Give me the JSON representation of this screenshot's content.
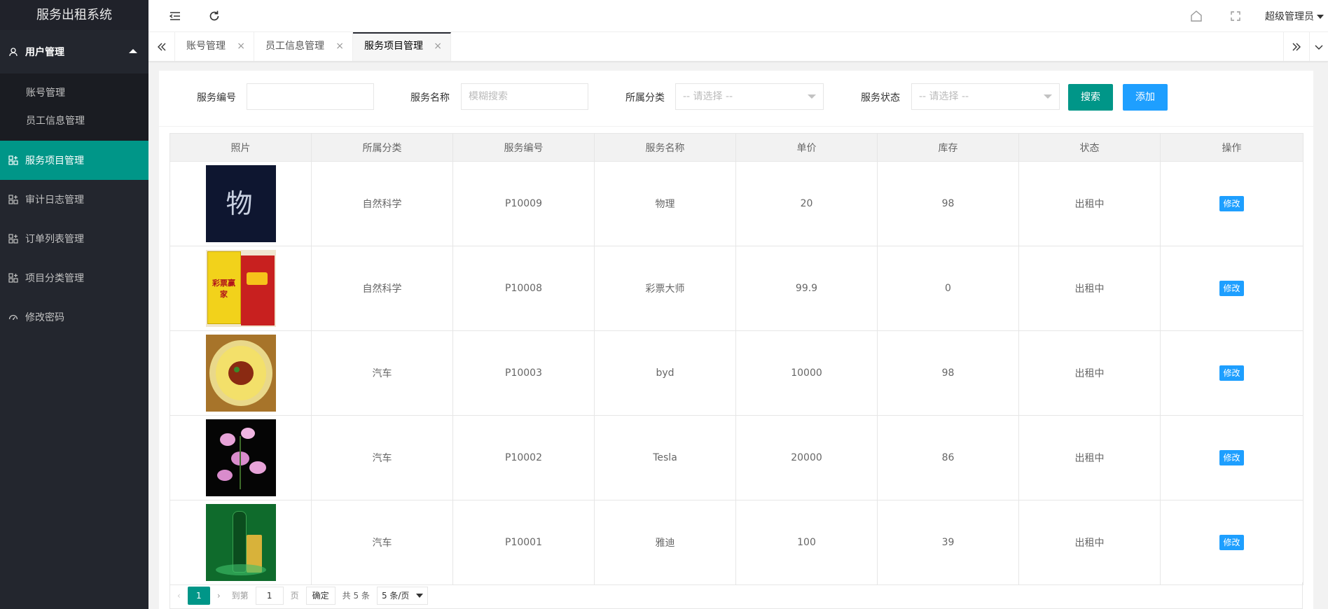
{
  "app": {
    "title": "服务出租系统"
  },
  "sidebar": {
    "group": {
      "label": "用户管理"
    },
    "sub_items": [
      {
        "label": "账号管理"
      },
      {
        "label": "员工信息管理"
      }
    ],
    "items": [
      {
        "label": "服务项目管理",
        "active": true
      },
      {
        "label": "审计日志管理"
      },
      {
        "label": "订单列表管理"
      },
      {
        "label": "项目分类管理"
      },
      {
        "label": "修改密码"
      }
    ]
  },
  "header": {
    "user": "超级管理员"
  },
  "tabs": [
    {
      "label": "账号管理",
      "close": "×"
    },
    {
      "label": "员工信息管理",
      "close": "×"
    },
    {
      "label": "服务项目管理",
      "close": "×",
      "active": true
    }
  ],
  "filters": {
    "code_label": "服务编号",
    "code_value": "",
    "name_label": "服务名称",
    "name_placeholder": "模糊搜索",
    "category_label": "所属分类",
    "category_placeholder": "-- 请选择 --",
    "status_label": "服务状态",
    "status_placeholder": "-- 请选择 --",
    "search_button": "搜索",
    "add_button": "添加"
  },
  "table": {
    "columns": [
      "照片",
      "所属分类",
      "服务编号",
      "服务名称",
      "单价",
      "库存",
      "状态",
      "操作"
    ],
    "rows": [
      {
        "photo": "物 理",
        "category": "自然科学",
        "code": "P10009",
        "name": "物理",
        "price": "20",
        "stock": "98",
        "status": "出租中",
        "action": "修改"
      },
      {
        "photo": "彩票赢家",
        "category": "自然科学",
        "code": "P10008",
        "name": "彩票大师",
        "price": "99.9",
        "stock": "0",
        "status": "出租中",
        "action": "修改"
      },
      {
        "photo": "",
        "category": "汽车",
        "code": "P10003",
        "name": "byd",
        "price": "10000",
        "stock": "98",
        "status": "出租中",
        "action": "修改"
      },
      {
        "photo": "",
        "category": "汽车",
        "code": "P10002",
        "name": "Tesla",
        "price": "20000",
        "stock": "86",
        "status": "出租中",
        "action": "修改"
      },
      {
        "photo": "",
        "category": "汽车",
        "code": "P10001",
        "name": "雅迪",
        "price": "100",
        "stock": "39",
        "status": "出租中",
        "action": "修改"
      }
    ]
  },
  "pagination": {
    "prev": "‹",
    "current": "1",
    "next": "›",
    "goto_label": "到第",
    "goto_value": "1",
    "page_unit": "页",
    "confirm": "确定",
    "total": "共 5 条",
    "page_size": "5 条/页"
  },
  "colors": {
    "sidebar_bg": "#23262e",
    "accent": "#009688",
    "primary_blue": "#1e9fff"
  }
}
